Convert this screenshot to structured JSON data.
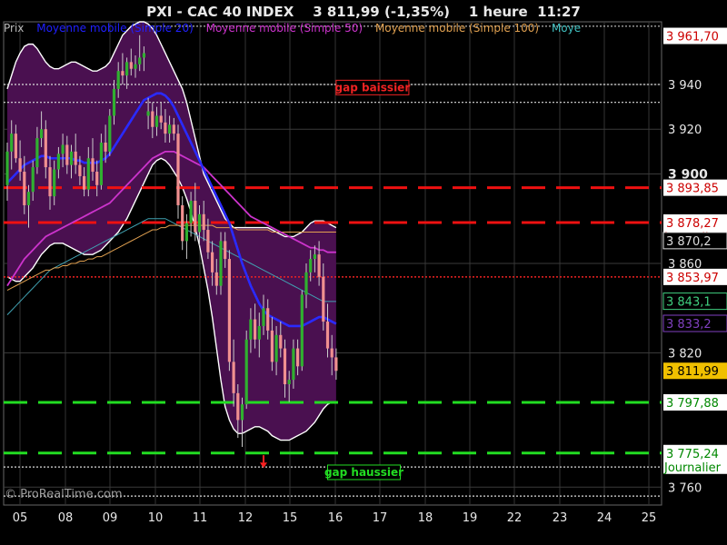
{
  "title": {
    "symbol": "PXI - CAC 40 INDEX",
    "last": "3 811,99",
    "change": "(-1,35%)",
    "period": "1 heure",
    "time": "11:27"
  },
  "legend": [
    {
      "label": "Prix",
      "color": "#bbbbbb"
    },
    {
      "label": "Moyenne mobile (Simple 20)",
      "color": "#2020ff"
    },
    {
      "label": "Moyenne mobile (Simple 50)",
      "color": "#cc33cc"
    },
    {
      "label": "Moyenne mobile (Simple 100)",
      "color": "#e0a050"
    },
    {
      "label": "Moye",
      "color": "#40c0c0"
    }
  ],
  "credit": "© ProRealTime.com",
  "chart_data": {
    "type": "candlestick",
    "ylim": [
      3752,
      3968
    ],
    "x_ticks": [
      "05",
      "08",
      "09",
      "10",
      "11",
      "12",
      "15",
      "16",
      "17",
      "18",
      "19",
      "22",
      "23",
      "24",
      "25"
    ],
    "y_ticks": [
      "3 940",
      "3 920",
      "3 900",
      "3 860",
      "3 820",
      "3 760"
    ],
    "y_tick_values": [
      3940,
      3920,
      3900,
      3860,
      3820,
      3760
    ],
    "y_tick_bold": [
      false,
      false,
      true,
      false,
      false,
      false
    ],
    "price_labels": [
      {
        "value": 3961.7,
        "text": "3 961,70",
        "bg": "#ffffff",
        "fg": "#cc0000"
      },
      {
        "value": 3893.85,
        "text": "3 893,85",
        "bg": "#ffffff",
        "fg": "#cc0000"
      },
      {
        "value": 3878.27,
        "text": "3 878,27",
        "sub": "Journalier",
        "bg": "#ffffff",
        "fg": "#cc0000"
      },
      {
        "value": 3870.2,
        "text": "3 870,2",
        "bg": "#000000",
        "fg": "#dddddd"
      },
      {
        "value": 3853.97,
        "text": "3 853,97",
        "bg": "#ffffff",
        "fg": "#cc0000"
      },
      {
        "value": 3843.1,
        "text": "3 843,1",
        "bg": "#000000",
        "fg": "#40d080"
      },
      {
        "value": 3833.2,
        "text": "3 833,2",
        "bg": "#000000",
        "fg": "#8040c0"
      },
      {
        "value": 3811.99,
        "text": "3 811,99",
        "bg": "#f0c000",
        "fg": "#000000"
      },
      {
        "value": 3797.88,
        "text": "3 797,88",
        "bg": "#ffffff",
        "fg": "#008800"
      },
      {
        "value": 3775.24,
        "text": "3 775,24",
        "sub": "Journalier",
        "bg": "#ffffff",
        "fg": "#008800"
      }
    ],
    "levels": [
      {
        "value": 3893.85,
        "style": "red-dash"
      },
      {
        "value": 3878.27,
        "style": "red-dash"
      },
      {
        "value": 3853.97,
        "style": "red-dot"
      },
      {
        "value": 3797.88,
        "style": "green-dash"
      },
      {
        "value": 3775.24,
        "style": "green-dash"
      },
      {
        "value": 3940.0,
        "style": "white-dot"
      },
      {
        "value": 3932.0,
        "style": "white-dot"
      },
      {
        "value": 3769.0,
        "style": "white-dot"
      },
      {
        "value": 3756.0,
        "style": "white-dot"
      },
      {
        "value": 3966.0,
        "style": "white-dot-short"
      }
    ],
    "annotations": [
      {
        "text": "gap baissier",
        "value": 3937,
        "x_index": 77,
        "color": "#ee2222"
      },
      {
        "text": "gap haussier",
        "value": 3765,
        "x_index": 75,
        "color": "#22dd22"
      }
    ],
    "arrow": {
      "x_index": 60,
      "value": 3771,
      "color": "#ff2020"
    },
    "candles": [
      [
        3895,
        3914,
        3888,
        3910
      ],
      [
        3910,
        3924,
        3902,
        3918
      ],
      [
        3918,
        3922,
        3905,
        3907
      ],
      [
        3907,
        3915,
        3897,
        3901
      ],
      [
        3901,
        3908,
        3882,
        3886
      ],
      [
        3886,
        3895,
        3876,
        3892
      ],
      [
        3892,
        3906,
        3888,
        3903
      ],
      [
        3903,
        3921,
        3900,
        3916
      ],
      [
        3916,
        3928,
        3912,
        3920
      ],
      [
        3920,
        3924,
        3898,
        3903
      ],
      [
        3903,
        3908,
        3884,
        3890
      ],
      [
        3890,
        3906,
        3886,
        3902
      ],
      [
        3902,
        3912,
        3898,
        3909
      ],
      [
        3909,
        3918,
        3903,
        3913
      ],
      [
        3913,
        3917,
        3900,
        3904
      ],
      [
        3904,
        3913,
        3898,
        3910
      ],
      [
        3910,
        3918,
        3900,
        3904
      ],
      [
        3904,
        3908,
        3895,
        3899
      ],
      [
        3899,
        3903,
        3890,
        3893
      ],
      [
        3893,
        3912,
        3890,
        3907
      ],
      [
        3907,
        3916,
        3897,
        3901
      ],
      [
        3901,
        3906,
        3890,
        3895
      ],
      [
        3895,
        3918,
        3893,
        3914
      ],
      [
        3914,
        3922,
        3905,
        3910
      ],
      [
        3910,
        3929,
        3908,
        3926
      ],
      [
        3926,
        3942,
        3922,
        3938
      ],
      [
        3938,
        3950,
        3934,
        3946
      ],
      [
        3946,
        3954,
        3940,
        3944
      ],
      [
        3944,
        3952,
        3938,
        3950
      ],
      [
        3950,
        3956,
        3944,
        3947
      ],
      [
        3947,
        3953,
        3943,
        3949
      ],
      [
        3949,
        3962,
        3946,
        3952
      ],
      [
        3952,
        3957,
        3946,
        3954
      ],
      [
        3926,
        3934,
        3920,
        3928
      ],
      [
        3928,
        3932,
        3916,
        3921
      ],
      [
        3921,
        3930,
        3917,
        3926
      ],
      [
        3926,
        3932,
        3920,
        3923
      ],
      [
        3923,
        3929,
        3914,
        3918
      ],
      [
        3918,
        3926,
        3914,
        3922
      ],
      [
        3922,
        3925,
        3915,
        3918
      ],
      [
        3918,
        3922,
        3880,
        3886
      ],
      [
        3886,
        3890,
        3866,
        3870
      ],
      [
        3870,
        3882,
        3862,
        3878
      ],
      [
        3878,
        3892,
        3872,
        3888
      ],
      [
        3888,
        3896,
        3870,
        3874
      ],
      [
        3874,
        3886,
        3868,
        3882
      ],
      [
        3882,
        3888,
        3870,
        3875
      ],
      [
        3875,
        3880,
        3862,
        3865
      ],
      [
        3865,
        3870,
        3850,
        3856
      ],
      [
        3856,
        3862,
        3846,
        3850
      ],
      [
        3850,
        3874,
        3846,
        3870
      ],
      [
        3870,
        3874,
        3858,
        3862
      ],
      [
        3862,
        3866,
        3812,
        3816
      ],
      [
        3816,
        3826,
        3796,
        3802
      ],
      [
        3802,
        3806,
        3782,
        3790
      ],
      [
        3790,
        3800,
        3778,
        3797
      ],
      [
        3797,
        3830,
        3795,
        3826
      ],
      [
        3826,
        3840,
        3820,
        3835
      ],
      [
        3835,
        3842,
        3822,
        3826
      ],
      [
        3826,
        3838,
        3818,
        3832
      ],
      [
        3832,
        3846,
        3828,
        3840
      ],
      [
        3840,
        3844,
        3826,
        3830
      ],
      [
        3830,
        3836,
        3812,
        3816
      ],
      [
        3816,
        3832,
        3810,
        3828
      ],
      [
        3828,
        3834,
        3818,
        3822
      ],
      [
        3822,
        3826,
        3800,
        3806
      ],
      [
        3806,
        3812,
        3798,
        3808
      ],
      [
        3808,
        3826,
        3804,
        3822
      ],
      [
        3822,
        3826,
        3810,
        3814
      ],
      [
        3814,
        3848,
        3812,
        3846
      ],
      [
        3846,
        3860,
        3840,
        3856
      ],
      [
        3856,
        3866,
        3852,
        3862
      ],
      [
        3862,
        3868,
        3856,
        3864
      ],
      [
        3864,
        3870,
        3850,
        3854
      ],
      [
        3854,
        3860,
        3830,
        3834
      ],
      [
        3834,
        3842,
        3818,
        3822
      ],
      [
        3822,
        3828,
        3810,
        3818
      ],
      [
        3818,
        3822,
        3808,
        3812
      ]
    ],
    "ma20": [
      3896,
      3898,
      3900,
      3902,
      3904,
      3905,
      3906,
      3907,
      3908,
      3908,
      3907,
      3907,
      3907,
      3907,
      3907,
      3907,
      3906,
      3906,
      3905,
      3905,
      3905,
      3905,
      3906,
      3907,
      3909,
      3912,
      3915,
      3918,
      3921,
      3924,
      3927,
      3930,
      3933,
      3934,
      3935,
      3936,
      3936,
      3935,
      3933,
      3930,
      3926,
      3922,
      3918,
      3914,
      3910,
      3906,
      3902,
      3898,
      3894,
      3890,
      3886,
      3882,
      3878,
      3872,
      3866,
      3860,
      3855,
      3850,
      3846,
      3842,
      3839,
      3837,
      3836,
      3835,
      3834,
      3833,
      3832,
      3832,
      3832,
      3832,
      3833,
      3834,
      3835,
      3836,
      3836,
      3835,
      3834,
      3833
    ],
    "ma50": [
      3850,
      3853,
      3856,
      3859,
      3862,
      3864,
      3866,
      3868,
      3870,
      3872,
      3873,
      3874,
      3875,
      3876,
      3877,
      3878,
      3879,
      3880,
      3881,
      3882,
      3883,
      3884,
      3885,
      3886,
      3887,
      3889,
      3891,
      3893,
      3895,
      3897,
      3899,
      3901,
      3903,
      3905,
      3907,
      3908,
      3909,
      3910,
      3910,
      3910,
      3909,
      3908,
      3907,
      3906,
      3905,
      3904,
      3903,
      3901,
      3899,
      3897,
      3895,
      3893,
      3891,
      3889,
      3887,
      3885,
      3883,
      3881,
      3880,
      3879,
      3878,
      3877,
      3876,
      3875,
      3874,
      3873,
      3872,
      3871,
      3870,
      3869,
      3868,
      3867,
      3867,
      3866,
      3866,
      3865,
      3865,
      3865
    ],
    "ma100": [
      3848,
      3849,
      3850,
      3851,
      3852,
      3853,
      3854,
      3855,
      3856,
      3857,
      3857,
      3858,
      3858,
      3859,
      3859,
      3860,
      3860,
      3861,
      3861,
      3862,
      3862,
      3863,
      3863,
      3864,
      3865,
      3866,
      3867,
      3868,
      3869,
      3870,
      3871,
      3872,
      3873,
      3874,
      3875,
      3875,
      3876,
      3876,
      3877,
      3877,
      3877,
      3877,
      3877,
      3877,
      3877,
      3877,
      3877,
      3877,
      3877,
      3876,
      3876,
      3876,
      3876,
      3876,
      3875,
      3875,
      3875,
      3875,
      3875,
      3875,
      3875,
      3875,
      3874,
      3874,
      3874,
      3874,
      3874,
      3874,
      3874,
      3874,
      3874,
      3874,
      3874,
      3874,
      3874,
      3874,
      3874,
      3874
    ],
    "ma_extra": [
      3837,
      3839,
      3841,
      3843,
      3845,
      3847,
      3849,
      3851,
      3853,
      3855,
      3857,
      3858,
      3859,
      3860,
      3861,
      3862,
      3863,
      3864,
      3865,
      3866,
      3867,
      3868,
      3869,
      3870,
      3871,
      3872,
      3873,
      3874,
      3875,
      3876,
      3877,
      3878,
      3879,
      3880,
      3880,
      3880,
      3880,
      3880,
      3879,
      3878,
      3877,
      3876,
      3875,
      3874,
      3873,
      3872,
      3871,
      3870,
      3869,
      3868,
      3867,
      3866,
      3865,
      3864,
      3863,
      3862,
      3861,
      3860,
      3859,
      3858,
      3857,
      3856,
      3855,
      3854,
      3853,
      3852,
      3851,
      3850,
      3849,
      3848,
      3847,
      3846,
      3845,
      3844,
      3843,
      3843,
      3843,
      3843
    ],
    "bb_upper": [
      3938,
      3944,
      3950,
      3954,
      3957,
      3958,
      3958,
      3956,
      3953,
      3950,
      3948,
      3947,
      3947,
      3948,
      3949,
      3950,
      3950,
      3949,
      3948,
      3947,
      3946,
      3946,
      3947,
      3948,
      3950,
      3954,
      3958,
      3962,
      3964,
      3966,
      3967,
      3968,
      3968,
      3967,
      3965,
      3962,
      3958,
      3954,
      3950,
      3946,
      3942,
      3938,
      3932,
      3924,
      3916,
      3908,
      3900,
      3896,
      3892,
      3888,
      3884,
      3880,
      3878,
      3876,
      3876,
      3876,
      3876,
      3876,
      3876,
      3876,
      3876,
      3876,
      3875,
      3874,
      3873,
      3872,
      3872,
      3872,
      3873,
      3874,
      3876,
      3878,
      3879,
      3879,
      3879,
      3878,
      3877,
      3876
    ],
    "bb_lower": [
      3854,
      3853,
      3852,
      3852,
      3854,
      3856,
      3858,
      3861,
      3864,
      3866,
      3868,
      3869,
      3869,
      3869,
      3868,
      3867,
      3866,
      3865,
      3864,
      3864,
      3864,
      3865,
      3866,
      3868,
      3870,
      3872,
      3874,
      3877,
      3880,
      3884,
      3888,
      3892,
      3896,
      3900,
      3904,
      3906,
      3907,
      3906,
      3904,
      3901,
      3898,
      3894,
      3889,
      3883,
      3876,
      3868,
      3858,
      3848,
      3836,
      3822,
      3808,
      3796,
      3790,
      3786,
      3784,
      3784,
      3785,
      3786,
      3787,
      3787,
      3786,
      3785,
      3783,
      3782,
      3781,
      3781,
      3781,
      3782,
      3783,
      3784,
      3785,
      3787,
      3789,
      3792,
      3795,
      3797,
      3798,
      3798
    ]
  }
}
